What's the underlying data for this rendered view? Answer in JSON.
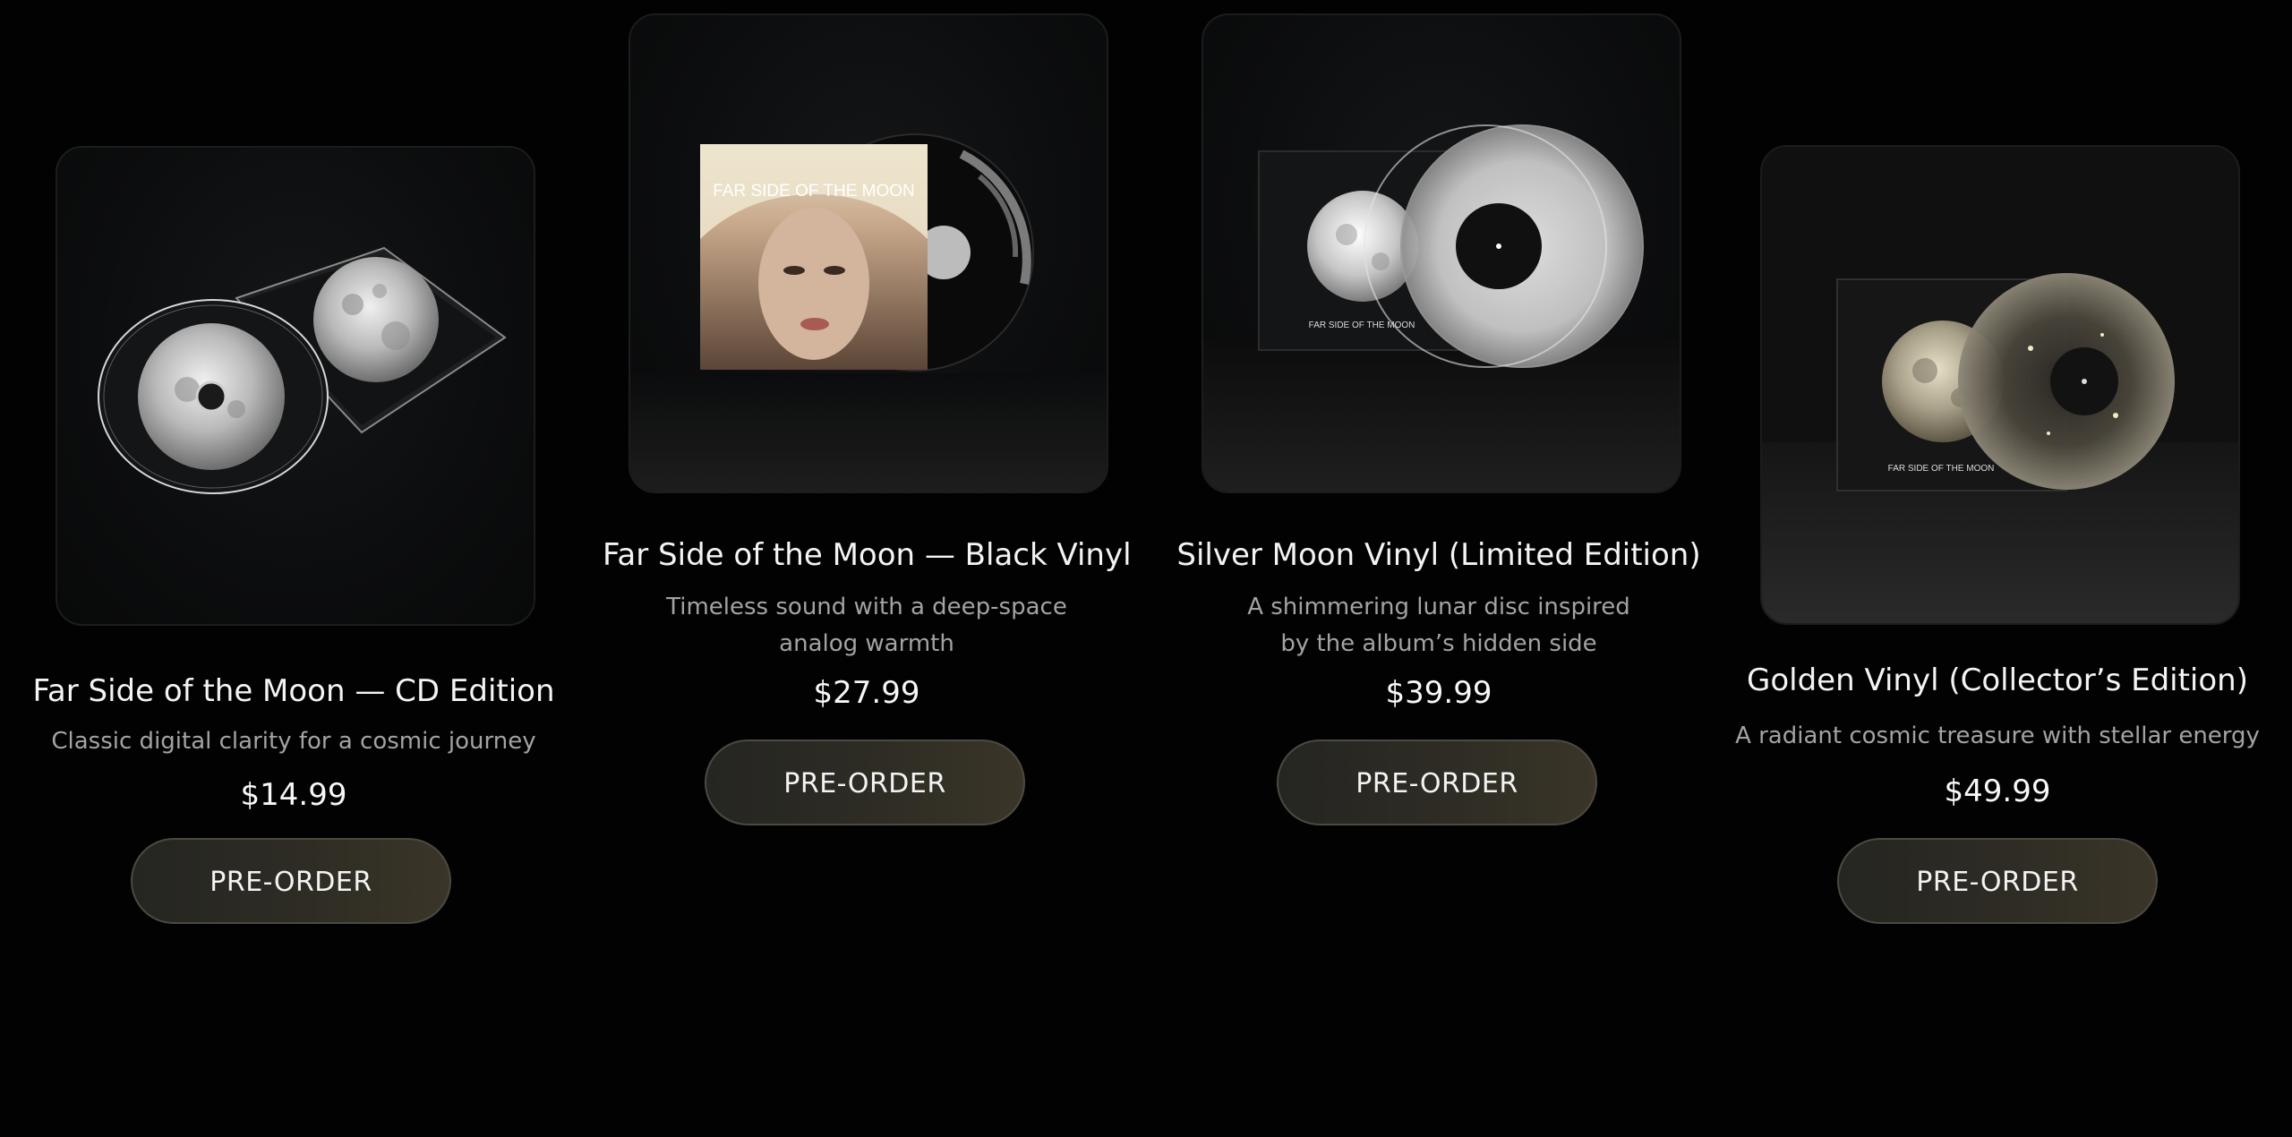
{
  "products": [
    {
      "title": "Far Side of the Moon — CD Edition",
      "description": "Classic digital clarity for a cosmic journey",
      "price": "$14.99",
      "button_label": "PRE-ORDER",
      "image_icon": "cd-case-moon-image"
    },
    {
      "title": "Far Side of the Moon — Black Vinyl",
      "description": "Timeless sound with a deep-space analog warmth",
      "price": "$27.99",
      "button_label": "PRE-ORDER",
      "cover_text": "FAR SIDE OF THE MOON",
      "image_icon": "black-vinyl-portrait-image"
    },
    {
      "title": "Silver Moon Vinyl (Limited Edition)",
      "description": "A shimmering lunar disc inspired by the album’s hidden side",
      "price": "$39.99",
      "button_label": "PRE-ORDER",
      "cover_text": "FAR SIDE OF THE MOON",
      "image_icon": "silver-vinyl-moon-image"
    },
    {
      "title": "Golden Vinyl (Collector’s Edition)",
      "description": "A radiant cosmic treasure with stellar energy",
      "price": "$49.99",
      "button_label": "PRE-ORDER",
      "cover_text": "FAR SIDE OF THE MOON",
      "image_icon": "golden-vinyl-moon-image"
    }
  ],
  "colors": {
    "background": "#020202",
    "button_fill": "#2e2c24",
    "button_border": "#4b4a40",
    "description_text": "#a3a3a3"
  }
}
